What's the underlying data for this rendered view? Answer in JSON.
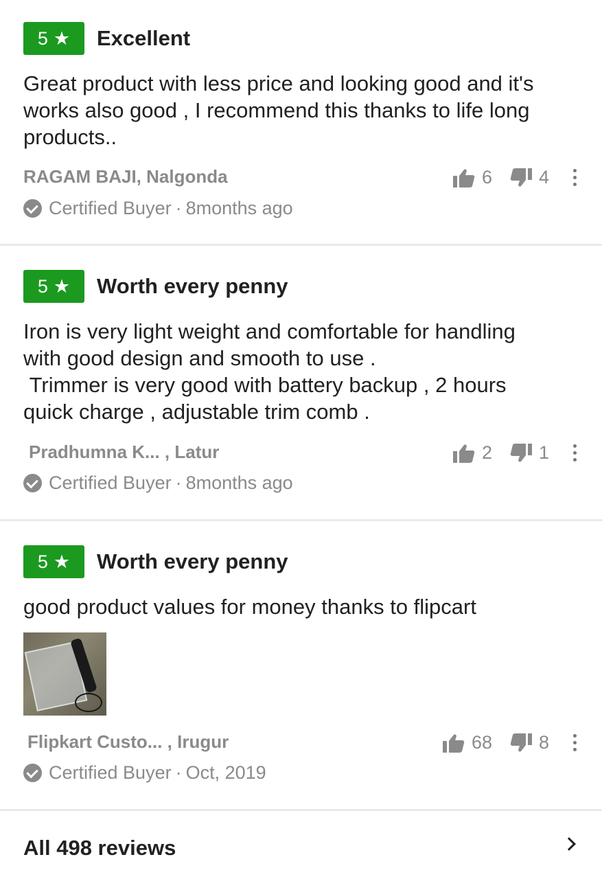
{
  "reviews": [
    {
      "rating": "5",
      "title": "Excellent",
      "body": "Great product with less price and looking good and it's\nworks also good , I recommend this thanks to life long\nproducts..",
      "author": "RAGAM BAJI, Nalgonda",
      "certified": "Certified Buyer",
      "time": "8months ago",
      "likes": "6",
      "dislikes": "4"
    },
    {
      "rating": "5",
      "title": "Worth every penny",
      "body": "Iron is very light weight and comfortable for handling\nwith good design and smooth to use .\n Trimmer is very good with battery backup , 2 hours\nquick charge , adjustable trim comb .",
      "author": "Pradhumna K... , Latur",
      "certified": "Certified Buyer",
      "time": "8months ago",
      "likes": "2",
      "dislikes": "1"
    },
    {
      "rating": "5",
      "title": "Worth every penny",
      "body": "good product values for money thanks to flipcart",
      "author": "Flipkart Custo... , Irugur",
      "certified": "Certified Buyer",
      "time": "Oct, 2019",
      "likes": "68",
      "dislikes": "8"
    }
  ],
  "separator": "·",
  "icons": {
    "star": "star-icon",
    "check": "check-circle-icon",
    "like": "thumbs-up-icon",
    "dislike": "thumbs-down-icon",
    "menu": "more-vertical-icon",
    "chevron": "chevron-right-icon"
  },
  "colors": {
    "rating_badge": "#1b9a1f",
    "muted_text": "#8a8a8a",
    "divider": "#e9e9e9"
  },
  "footer": {
    "all_reviews": "All 498 reviews"
  }
}
